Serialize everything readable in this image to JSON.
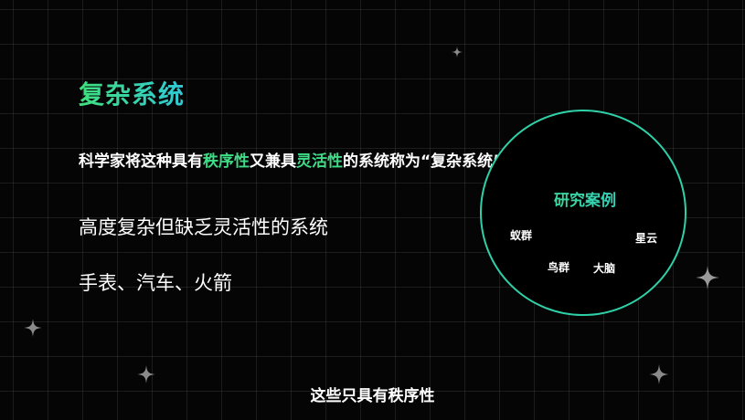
{
  "slide": {
    "title": "复杂系统",
    "intro": {
      "part1": "科学家将这种具有",
      "highlight1": "秩序性",
      "part2": "又兼具",
      "highlight2": "灵活性",
      "part3": "的系统称为“复杂系统”。"
    },
    "line1": "高度复杂但缺乏灵活性的系统",
    "line2": "手表、汽车、火箭",
    "circle": {
      "title": "研究案例",
      "cases": [
        "蚁群",
        "星云",
        "鸟群",
        "大脑"
      ]
    },
    "subtitle": "这些只具有秩序性"
  },
  "colors": {
    "accent_green": "#3fe07d",
    "accent_cyan": "#2fc8d8",
    "background": "#050505"
  },
  "icons": [
    "sparkle-icon"
  ]
}
